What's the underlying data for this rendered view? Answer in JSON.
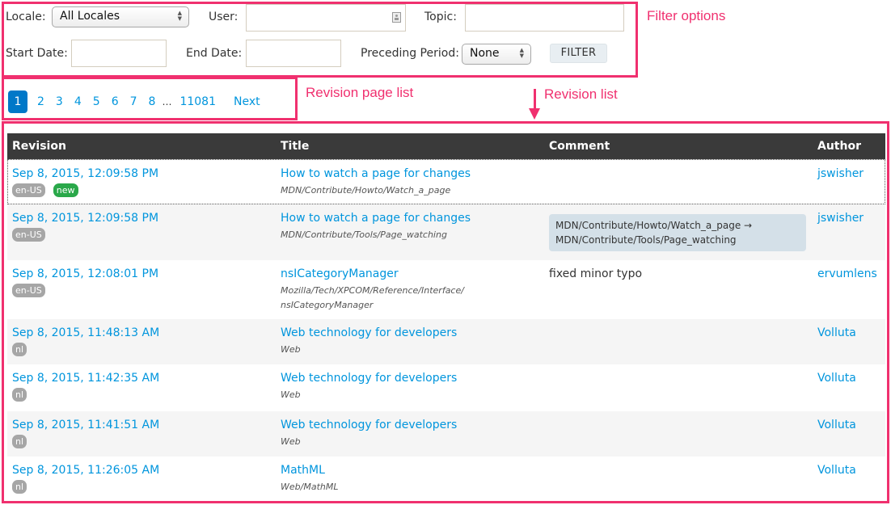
{
  "annotations": {
    "filter_options": "Filter options",
    "revision_page_list": "Revision page list",
    "revision_list": "Revision list"
  },
  "filters": {
    "locale_label": "Locale:",
    "locale_value": "All Locales",
    "user_label": "User:",
    "user_value": "",
    "topic_label": "Topic:",
    "topic_value": "",
    "start_date_label": "Start Date:",
    "start_date_value": "",
    "end_date_label": "End Date:",
    "end_date_value": "",
    "preceding_period_label": "Preceding Period:",
    "preceding_period_value": "None",
    "filter_button": "FILTER"
  },
  "pagination": {
    "pages": [
      "1",
      "2",
      "3",
      "4",
      "5",
      "6",
      "7",
      "8"
    ],
    "current": "1",
    "ellipsis": "…",
    "last_page": "11081",
    "next": "Next"
  },
  "table": {
    "headers": [
      "Revision",
      "Title",
      "Comment",
      "Author"
    ],
    "rows": [
      {
        "date": "Sep 8, 2015, 12:09:58 PM",
        "locale": "en-US",
        "new": "new",
        "title": "How to watch a page for changes",
        "slug": "MDN/Contribute/Howto/Watch_a_page",
        "comment": "",
        "author": "jswisher"
      },
      {
        "date": "Sep 8, 2015, 12:09:58 PM",
        "locale": "en-US",
        "title": "How to watch a page for changes",
        "slug": "MDN/Contribute/Tools/Page_watching",
        "comment_box": "MDN/Contribute/Howto/Watch_a_page → MDN/Contribute/Tools/Page_watching",
        "author": "jswisher"
      },
      {
        "date": "Sep 8, 2015, 12:08:01 PM",
        "locale": "en-US",
        "title": "nsICategoryManager",
        "slug": "Mozilla/Tech/XPCOM/Reference/Interface/nsICategoryManager",
        "comment": "fixed minor typo",
        "author": "ervumlens"
      },
      {
        "date": "Sep 8, 2015, 11:48:13 AM",
        "locale": "nl",
        "title": "Web technology for developers",
        "slug": "Web",
        "comment": "",
        "author": "Volluta"
      },
      {
        "date": "Sep 8, 2015, 11:42:35 AM",
        "locale": "nl",
        "title": "Web technology for developers",
        "slug": "Web",
        "comment": "",
        "author": "Volluta"
      },
      {
        "date": "Sep 8, 2015, 11:41:51 AM",
        "locale": "nl",
        "title": "Web technology for developers",
        "slug": "Web",
        "comment": "",
        "author": "Volluta"
      },
      {
        "date": "Sep 8, 2015, 11:26:05 AM",
        "locale": "nl",
        "title": "MathML",
        "slug": "Web/MathML",
        "comment": "",
        "author": "Volluta"
      }
    ]
  }
}
